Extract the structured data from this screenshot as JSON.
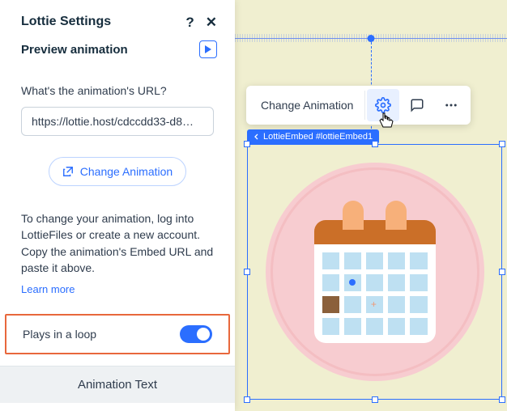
{
  "panel": {
    "title": "Lottie Settings",
    "preview_label": "Preview animation",
    "url_label": "What's the animation's URL?",
    "url_value": "https://lottie.host/cdccdd33-d8…",
    "change_btn": "Change Animation",
    "help_text": "To change your animation, log into LottieFiles or create a new account. Copy the animation's Embed URL and paste it above.",
    "learn_more": "Learn more",
    "loop_label": "Plays in a loop",
    "footer": "Animation Text"
  },
  "toolbar": {
    "change_label": "Change Animation"
  },
  "tag": {
    "label": "LottieEmbed #lottieEmbed1"
  }
}
